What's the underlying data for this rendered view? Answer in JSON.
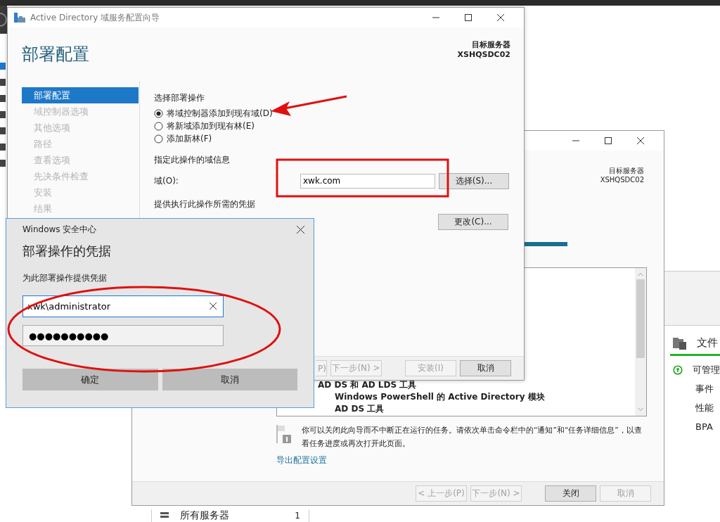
{
  "server_manager": {
    "tile": {
      "title": "文件",
      "rows": [
        {
          "kind": "status",
          "label": "可管理"
        },
        {
          "kind": "plain",
          "label": "事件"
        },
        {
          "kind": "plain",
          "label": "性能"
        },
        {
          "kind": "plain",
          "label": "BPA"
        }
      ]
    },
    "server_group": {
      "label": "所有服务器",
      "count": "1"
    }
  },
  "background_wizard": {
    "target_server_label": "目标服务器",
    "target_server": "XSHQSDC02",
    "results": [
      {
        "text": "AD DS 和 AD LDS 工具",
        "children": [
          {
            "text": "Windows PowerShell 的 Active Directory 模块"
          },
          {
            "text": "AD DS 工具"
          }
        ]
      }
    ],
    "notice": "你可以关闭此向导而不中断正在运行的任务。请依次单击命令栏中的“通知”和“任务详细信息”，以查看任务进度或再次打开此页面。",
    "link": "导出配置设置",
    "buttons": [
      {
        "label": "< 上一步(P)",
        "disabled": true
      },
      {
        "label": "下一步(N) >",
        "disabled": true
      },
      {
        "label": "关闭",
        "disabled": false
      },
      {
        "label": "取消",
        "disabled": true
      }
    ]
  },
  "wizard": {
    "title": "Active Directory 域服务配置向导",
    "heading": "部署配置",
    "target_server_label": "目标服务器",
    "target_server": "XSHQSDC02",
    "steps": [
      {
        "label": "部署配置",
        "selected": true
      },
      {
        "label": "域控制器选项",
        "selected": false
      },
      {
        "label": "其他选项",
        "selected": false
      },
      {
        "label": "路径",
        "selected": false
      },
      {
        "label": "查看选项",
        "selected": false
      },
      {
        "label": "先决条件检查",
        "selected": false
      },
      {
        "label": "安装",
        "selected": false
      },
      {
        "label": "结果",
        "selected": false
      }
    ],
    "operation": {
      "label": "选择部署操作",
      "options": [
        {
          "label": "将域控制器添加到现有域(D)",
          "selected": true
        },
        {
          "label": "将新域添加到现有林(E)",
          "selected": false
        },
        {
          "label": "添加新林(F)",
          "selected": false
        }
      ]
    },
    "domain_info": {
      "label": "指定此操作的域信息",
      "field_label": "域(O):",
      "value": "xwk.com",
      "button": "选择(S)..."
    },
    "credentials": {
      "label": "提供执行此操作所需的凭据",
      "button": "更改(C)..."
    },
    "buttons": [
      {
        "label": "P)",
        "disabled": true
      },
      {
        "label": "下一步(N) >",
        "disabled": true
      },
      {
        "label": "安装(I)",
        "disabled": true
      },
      {
        "label": "取消",
        "disabled": false
      }
    ]
  },
  "credential_dialog": {
    "title": "Windows 安全中心",
    "heading": "部署操作的凭据",
    "prompt": "为此部署操作提供凭据",
    "username": "xwk\\administrator",
    "password": "●●●●●●●●●●",
    "buttons": [
      "确定",
      "取消"
    ]
  }
}
